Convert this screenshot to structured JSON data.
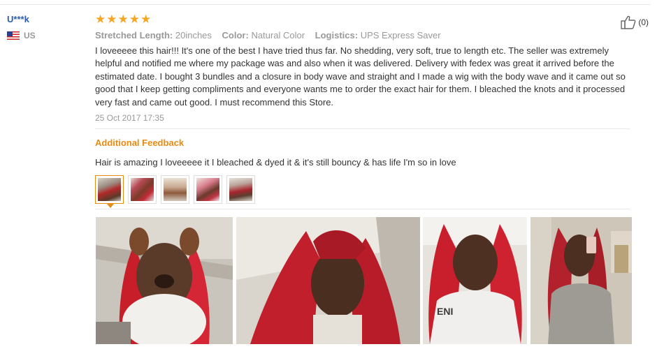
{
  "reviewer": {
    "name": "U***k",
    "country": "US"
  },
  "rating": {
    "stars": 5,
    "stars_text": "★★★★★"
  },
  "meta": [
    {
      "key": "Stretched Length:",
      "value": "20inches"
    },
    {
      "key": "Color:",
      "value": "Natural Color"
    },
    {
      "key": "Logistics:",
      "value": "UPS Express Saver"
    }
  ],
  "review_text": "I loveeeee this hair!!! It's one of the best I have tried thus far. No shedding, very soft, true to length etc. The seller was extremely helpful and notified me where my package was and also when it was delivered. Delivery with fedex was great it arrived before the estimated date. I bought 3 bundles and a closure in body wave and straight and I made a wig with the body wave and it came out so good that I keep getting compliments and everyone wants me to order the exact hair for them. I bleached the knots and it processed very fast and came out good. I must recommend this Store.",
  "review_date": "25 Oct 2017 17:35",
  "additional_feedback": {
    "title": "Additional Feedback",
    "text": "Hair is amazing I loveeeee it I bleached & dyed it & it's still bouncy & has life I'm so in love"
  },
  "helpful": {
    "count_text": "(0)"
  },
  "thumbnails_count": 5,
  "photos_count": 4,
  "colors": {
    "accent": "#e88b12",
    "star": "#f5a623",
    "username": "#2a5ea8",
    "muted": "#999999"
  }
}
